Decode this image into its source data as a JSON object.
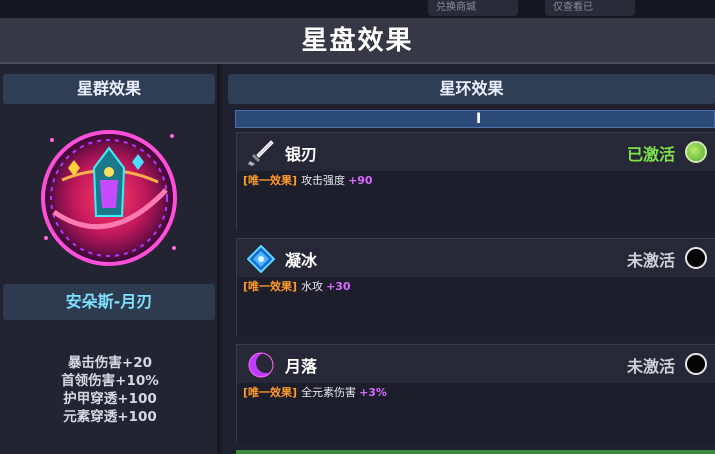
{
  "top_strip": {
    "chips": [
      "兑换商城",
      "仅查看已"
    ]
  },
  "title": "星盘效果",
  "left_panel": {
    "header": "星群效果",
    "constellation_name": "安朵斯-月刃",
    "stats": [
      "暴击伤害+20",
      "首领伤害+10%",
      "护甲穿透+100",
      "元素穿透+100"
    ]
  },
  "right_panel": {
    "header": "星环效果",
    "scroll_grip": "I",
    "cards": [
      {
        "icon": "sword-icon",
        "name": "银刃",
        "status": "已激活",
        "active": true,
        "tag": "[唯一效果]",
        "desc": "攻击强度",
        "value": "+90"
      },
      {
        "icon": "ice-crystal-icon",
        "name": "凝冰",
        "status": "未激活",
        "active": false,
        "tag": "[唯一效果]",
        "desc": "水攻",
        "value": "+30"
      },
      {
        "icon": "crescent-moon-icon",
        "name": "月落",
        "status": "未激活",
        "active": false,
        "tag": "[唯一效果]",
        "desc": "全元素伤害",
        "value": "+3%"
      }
    ]
  },
  "colors": {
    "active_status": "#7ee24a",
    "tag": "#ff9a2a",
    "value": "#d86aff",
    "name_cyan": "#7ee0ff"
  }
}
